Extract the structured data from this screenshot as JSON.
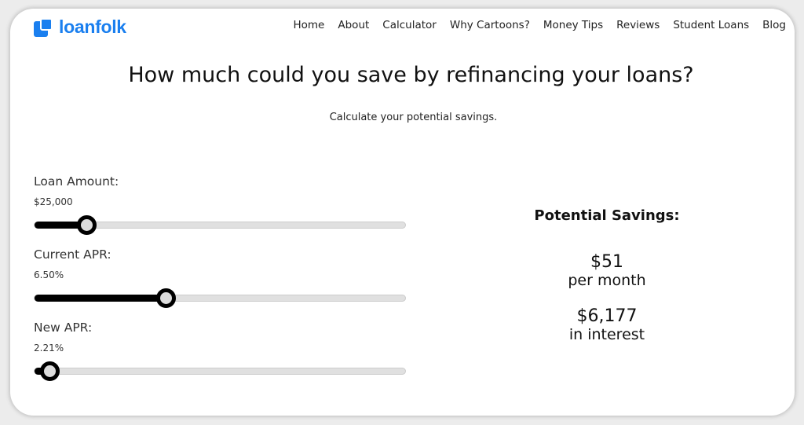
{
  "brand": {
    "name": "loanfolk",
    "color": "#1a7fef"
  },
  "nav": [
    "Home",
    "About",
    "Calculator",
    "Why Cartoons?",
    "Money Tips",
    "Reviews",
    "Student Loans",
    "Blog"
  ],
  "title": "How much could you save by refinancing your loans?",
  "subtitle": "Calculate your potential savings.",
  "sliders": [
    {
      "label": "Loan Amount:",
      "value": "$25,000",
      "fraction": 0.14
    },
    {
      "label": "Current APR:",
      "value": "6.50%",
      "fraction": 0.354
    },
    {
      "label": "New APR:",
      "value": "2.21%",
      "fraction": 0.04
    }
  ],
  "results": {
    "title": "Potential Savings:",
    "monthly": "$51",
    "monthly_unit": "per month",
    "interest": "$6,177",
    "interest_unit": "in interest"
  }
}
